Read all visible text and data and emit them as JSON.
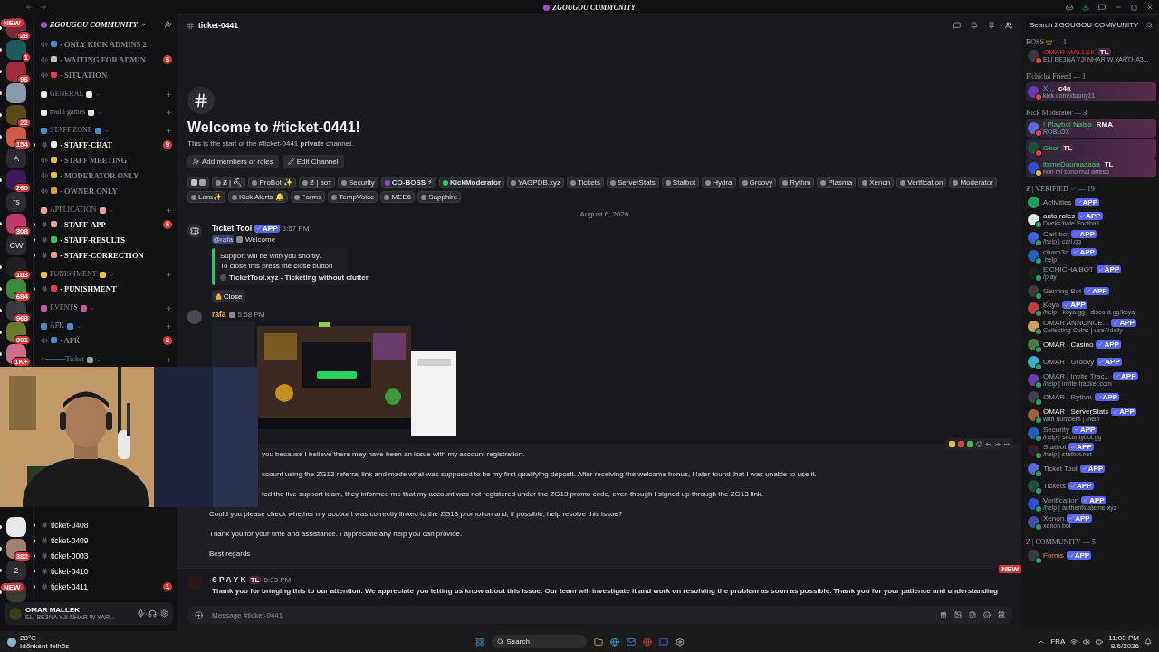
{
  "title_bar": {
    "title": "ZGOUGOU COMMUNITY"
  },
  "servers": [
    {
      "pill": "NEW",
      "badge": "28",
      "color": "#7a2a3a",
      "unread": true
    },
    {
      "badge": "1",
      "color": "#1e5a5a",
      "unread": true
    },
    {
      "badge": "96",
      "color": "#a02a3a",
      "unread": true
    },
    {
      "color": "#8a9aa8",
      "unread": true
    },
    {
      "badge": "22",
      "color": "#5a4a1a",
      "unread": true
    },
    {
      "badge": "154",
      "color": "#d05a4a",
      "unread": true
    },
    {
      "label": "A",
      "color": "#2a2a30",
      "unread": false
    },
    {
      "badge": "260",
      "color": "#3a1a5a",
      "unread": true
    },
    {
      "label": "rs",
      "color": "#2a2a30",
      "unread": false
    },
    {
      "badge": "308",
      "color": "#c03a6a",
      "unread": true
    },
    {
      "label": "CW",
      "color": "#2a2a30",
      "unread": false
    },
    {
      "badge": "183",
      "color": "#202020",
      "unread": true
    },
    {
      "badge": "684",
      "color": "#3a8a3a",
      "unread": true
    },
    {
      "badge": "968",
      "color": "#3a3a40",
      "unread": true
    },
    {
      "badge": "901",
      "color": "#6a7a2a",
      "unread": true
    },
    {
      "badge": "1K+",
      "color": "#d06a8a",
      "unread": true
    }
  ],
  "servers_lower": [
    {
      "color": "#e8e8e8",
      "unread": true
    },
    {
      "badge": "382",
      "color": "#a08070",
      "unread": true
    },
    {
      "label": "2",
      "color": "#2a2a30",
      "unread": true
    },
    {
      "pill": "NEW",
      "color": "#3a3a30",
      "unread": true
    }
  ],
  "server_header": {
    "name": "ZGOUGOU COMMUNITY"
  },
  "channels": [
    {
      "kind": "voice",
      "name": "· ONLY KICK ADMINS 2",
      "unread": false
    },
    {
      "kind": "voice",
      "name": "· WAITING FOR ADMIN",
      "unread": false,
      "badge": "6"
    },
    {
      "kind": "voice",
      "name": "· SITUATION",
      "unread": false
    },
    {
      "kind": "category",
      "name": "GENERAL"
    },
    {
      "kind": "category",
      "name": "multi games"
    },
    {
      "kind": "category",
      "name": "STAFF ZONE"
    },
    {
      "kind": "text",
      "name": "· STAFF-CHAT",
      "unread": true,
      "badge": "9"
    },
    {
      "kind": "voice",
      "name": "· STAFF MEETING",
      "unread": false
    },
    {
      "kind": "voice",
      "name": "· MODERATOR ONLY",
      "unread": false
    },
    {
      "kind": "voice",
      "name": "· OWNER ONLY",
      "unread": false
    },
    {
      "kind": "category",
      "name": "APPLICATION"
    },
    {
      "kind": "text",
      "name": "· STAFF-APP",
      "unread": true,
      "badge": "6"
    },
    {
      "kind": "text",
      "name": "· STAFF-RESULTS",
      "unread": true
    },
    {
      "kind": "text",
      "name": "· STAFF-CORRECTION",
      "unread": true
    },
    {
      "kind": "category",
      "name": "PUNISHMENT"
    },
    {
      "kind": "text",
      "name": "· PUNISHMENT",
      "unread": true
    },
    {
      "kind": "category",
      "name": "EVENTS"
    },
    {
      "kind": "category",
      "name": "AFK"
    },
    {
      "kind": "voice",
      "name": "· AFK",
      "unread": false,
      "badge": "2"
    },
    {
      "kind": "category",
      "name": "○────Ticket"
    }
  ],
  "channels_lower": [
    {
      "kind": "text",
      "name": "ticket-0408",
      "unread": true
    },
    {
      "kind": "text",
      "name": "ticket-0409",
      "unread": true
    },
    {
      "kind": "text",
      "name": "ticket-0003",
      "unread": true
    },
    {
      "kind": "text",
      "name": "ticket-0410",
      "unread": true
    },
    {
      "kind": "text",
      "name": "ticket-0411",
      "unread": true,
      "badge": "1"
    }
  ],
  "user_panel": {
    "name": "OMAR MALLEK",
    "status": "ELI BE3NA YJI NHAR W YAR..."
  },
  "channel_header": {
    "name": "ticket-0441"
  },
  "search": {
    "placeholder": "Search ZGOUGOU COMMUNITY"
  },
  "welcome": {
    "title": "Welcome to #ticket-0441!",
    "subtitle": "This is the start of the #ticket-0441 **private** channel.",
    "buttons": [
      "Add members or roles",
      "Edit Channel"
    ]
  },
  "roles": [
    {
      "kind": "icons"
    },
    {
      "kind": "role",
      "label": "Ƶ | ⛏",
      "color": "#8a8a90",
      "bold": false
    },
    {
      "kind": "role",
      "label": "ProBot ✨",
      "color": "#8a8a90",
      "bold": false
    },
    {
      "kind": "role",
      "label": "Ƶ | ʙᴏᴛ",
      "color": "#8a8a90",
      "bold": false
    },
    {
      "kind": "role",
      "label": "Security",
      "color": "#8a8a90",
      "bold": false
    },
    {
      "kind": "role",
      "label": "CO-BOSS ⚡",
      "color": "#8a4ae0",
      "bold": true
    },
    {
      "kind": "role",
      "label": "KickModerator",
      "color": "#2ad05a",
      "bold": true
    },
    {
      "kind": "role",
      "label": "YAGPDB.xyz",
      "color": "#8a8a90",
      "bold": false
    },
    {
      "kind": "role",
      "label": "Tickets",
      "color": "#8a8a90",
      "bold": false
    },
    {
      "kind": "role",
      "label": "ServerStats",
      "color": "#8a8a90",
      "bold": false
    },
    {
      "kind": "role",
      "label": "Statbot",
      "color": "#8a8a90",
      "bold": false
    },
    {
      "kind": "role",
      "label": "Hydra",
      "color": "#8a8a90",
      "bold": false
    },
    {
      "kind": "role",
      "label": "Groovy",
      "color": "#8a8a90",
      "bold": false
    },
    {
      "kind": "role",
      "label": "Rythm",
      "color": "#8a8a90",
      "bold": false
    },
    {
      "kind": "role",
      "label": "Plasma",
      "color": "#8a8a90",
      "bold": false
    },
    {
      "kind": "role",
      "label": "Xenon",
      "color": "#8a8a90",
      "bold": false
    },
    {
      "kind": "role",
      "label": "Verification",
      "color": "#8a8a90",
      "bold": false
    },
    {
      "kind": "role",
      "label": "Moderator",
      "color": "#8a8a90",
      "bold": false
    },
    {
      "kind": "role",
      "label": "Lara✨",
      "color": "#8a8a90",
      "bold": false
    },
    {
      "kind": "role",
      "label": "Kick Alerts 🔔",
      "color": "#8a8a90",
      "bold": false
    },
    {
      "kind": "role",
      "label": "Forms",
      "color": "#8a8a90",
      "bold": false
    },
    {
      "kind": "role",
      "label": "TempVoice",
      "color": "#8a8a90",
      "bold": false
    },
    {
      "kind": "role",
      "label": "MEE6",
      "color": "#8a8a90",
      "bold": false
    },
    {
      "kind": "role",
      "label": "Sapphire",
      "color": "#8a8a90",
      "bold": false
    }
  ],
  "date_divider": "August 6, 2026",
  "messages": [
    {
      "kind": "bot",
      "author": "Ticket Tool",
      "tag": "APP",
      "time": "5:57 PM",
      "mention": "@rafa",
      "text": "Welcome",
      "embed": {
        "lines": [
          "Support will be with you shortly.",
          "To close this press the close button"
        ],
        "footer": "TicketTool.xyz - Ticketing without clutter"
      },
      "button": "Close"
    },
    {
      "kind": "attachment",
      "author": "rafa",
      "time": "5:58 PM"
    },
    {
      "kind": "continuation",
      "hovered": true,
      "lines": [
        {
          "text": "you because I believe there may have been an issue with my account registration.",
          "covered": true
        },
        {
          "text": "ccount using the ZG13 referral link and made what was supposed to be my first qualifying deposit. After receiving the welcome bonus, I later found that I was unable to use it.",
          "covered": true
        },
        {
          "text": "ted the live support team, they informed me that my account was not registered under the ZG13 promo code, even though I signed up through the ZG13 link.",
          "covered": true
        },
        {
          "text": "Could you please check whether my account was correctly linked to the ZG13 promotion and, if possible, help resolve this issue?",
          "covered": false
        },
        {
          "text": "Thank you for your time and assistance. I appreciate any help you can provide.",
          "covered": false
        },
        {
          "text": "Best regards",
          "covered": false
        }
      ]
    },
    {
      "kind": "divider",
      "label": "NEW"
    },
    {
      "kind": "user",
      "author": "S P A Y K",
      "tag": "TL",
      "time": "9:33 PM",
      "text": "Thank you for bringing this to our attention. We appreciate you letting us know about this issue. Our team will investigate it and work on resolving the problem as soon as possible. Thank you for your patience and understanding"
    }
  ],
  "composer": {
    "placeholder": "Message #ticket-0441"
  },
  "member_groups": [
    {
      "title": "BOSS",
      "count": "— 1",
      "kind": "crown",
      "members": [
        {
          "name": "OMAR MALLEK",
          "kind": "boss",
          "tag": "TL",
          "sub": "ELI BE3NA YJI NHAR W YARTHA3...",
          "color": "#f23f43",
          "banner": false
        }
      ]
    },
    {
      "title": "E'chicha Friend",
      "count": "— 1",
      "kind": "plain",
      "members": [
        {
          "name": "X...",
          "kind": "friend",
          "tag": "c4a",
          "sub": "kick.com/xtoony11",
          "color": "#f23f43",
          "banner": true
        }
      ]
    },
    {
      "title": "Kick Moderator",
      "count": "— 3",
      "kind": "plain",
      "members": [
        {
          "name": "! Playboi Natso",
          "kind": "moderator",
          "tag": "RMA",
          "sub": "ROBLOX",
          "color": "#f23f43",
          "banner": true
        },
        {
          "name": "Ghof",
          "kind": "moderator",
          "tag": "TL",
          "color": "#f23f43",
          "banner": true
        },
        {
          "name": "itsmeDoumaaaaa",
          "kind": "moderator",
          "tag": "TL",
          "sub": "non mi sono mai arreso",
          "color": "#f0b232",
          "banner": true
        }
      ]
    },
    {
      "title": "Ƶ | VERIFIED",
      "count": "— 19",
      "kind": "check",
      "members": [
        {
          "name": "Activities",
          "kind": "bot",
          "app": "APP",
          "banner": false
        },
        {
          "name": "auto roles",
          "kind": "bot_bright",
          "app": "APP",
          "sub": "Ducks hate Football.",
          "color": "#23a55a",
          "banner": false
        },
        {
          "name": "Carl-bot",
          "kind": "bot",
          "app": "APP",
          "sub": "/help | carl.gg",
          "color": "#23a55a",
          "banner": false
        },
        {
          "name": "cham3a",
          "kind": "bot",
          "app": "APP",
          "sub": ".help",
          "color": "#23a55a",
          "banner": false
        },
        {
          "name": "E'CHICHA BOT",
          "kind": "bot",
          "app": "APP",
          "sub": "/play",
          "color": "#23a55a",
          "banner": false
        },
        {
          "name": "Gaming Bot",
          "kind": "bot",
          "app": "APP",
          "color": "#23a55a",
          "banner": false
        },
        {
          "name": "Koya",
          "kind": "bot",
          "app": "APP",
          "sub": "/help · koya.gg · discord.gg/koya",
          "color": "#23a55a",
          "banner": false
        },
        {
          "name": "OMAR ANNONCE...",
          "kind": "bot",
          "app": "APP",
          "sub": "Collecting Coins | use ?daily",
          "color": "#23a55a",
          "banner": false
        },
        {
          "name": "OMAR | Casino",
          "kind": "bot_bright",
          "app": "APP",
          "color": "#23a55a",
          "banner": false
        },
        {
          "name": "OMAR | Groovy",
          "kind": "bot",
          "app": "APP",
          "color": "#23a55a",
          "banner": false
        },
        {
          "name": "OMAR | Invite Trac...",
          "kind": "bot",
          "app": "APP",
          "sub": "/help | invite-tracker.com",
          "color": "#23a55a",
          "banner": false
        },
        {
          "name": "OMAR | Rythm",
          "kind": "bot",
          "app": "APP",
          "color": "#23a55a",
          "banner": false
        },
        {
          "name": "OMAR | ServerStats",
          "kind": "bot_bright",
          "app": "APP",
          "sub": "with numbers | /help",
          "color": "#23a55a",
          "banner": false
        },
        {
          "name": "Security",
          "kind": "bot",
          "app": "APP",
          "sub": "/help | securitybot.gg",
          "color": "#23a55a",
          "banner": false
        },
        {
          "name": "Statbot",
          "kind": "bot",
          "app": "APP",
          "sub": "/help | statbot.net",
          "color": "#23a55a",
          "banner": false
        },
        {
          "name": "Ticket Tool",
          "kind": "bot",
          "app": "APP",
          "color": "#23a55a",
          "banner": false
        },
        {
          "name": "Tickets",
          "kind": "bot",
          "app": "APP",
          "color": "#23a55a",
          "banner": false
        },
        {
          "name": "Verification",
          "kind": "bot",
          "app": "APP",
          "sub": "/help | authenticateme.xyz",
          "color": "#23a55a",
          "banner": false
        },
        {
          "name": "Xenon",
          "kind": "bot",
          "app": "APP",
          "sub": "xenon.bot",
          "color": "#23a55a",
          "banner": false
        }
      ]
    },
    {
      "title": "Ƶ | COMMUNITY",
      "count": "— 5",
      "kind": "plain",
      "members": [
        {
          "name": "Forms",
          "kind": "community",
          "app": "APP",
          "color": "#23a55a",
          "banner": false
        }
      ]
    }
  ],
  "taskbar": {
    "temp": "28°C",
    "weather": "Időnként felhős",
    "search": "Search",
    "lang": "FRA",
    "time": "11:03 PM",
    "date": "8/6/2026"
  }
}
